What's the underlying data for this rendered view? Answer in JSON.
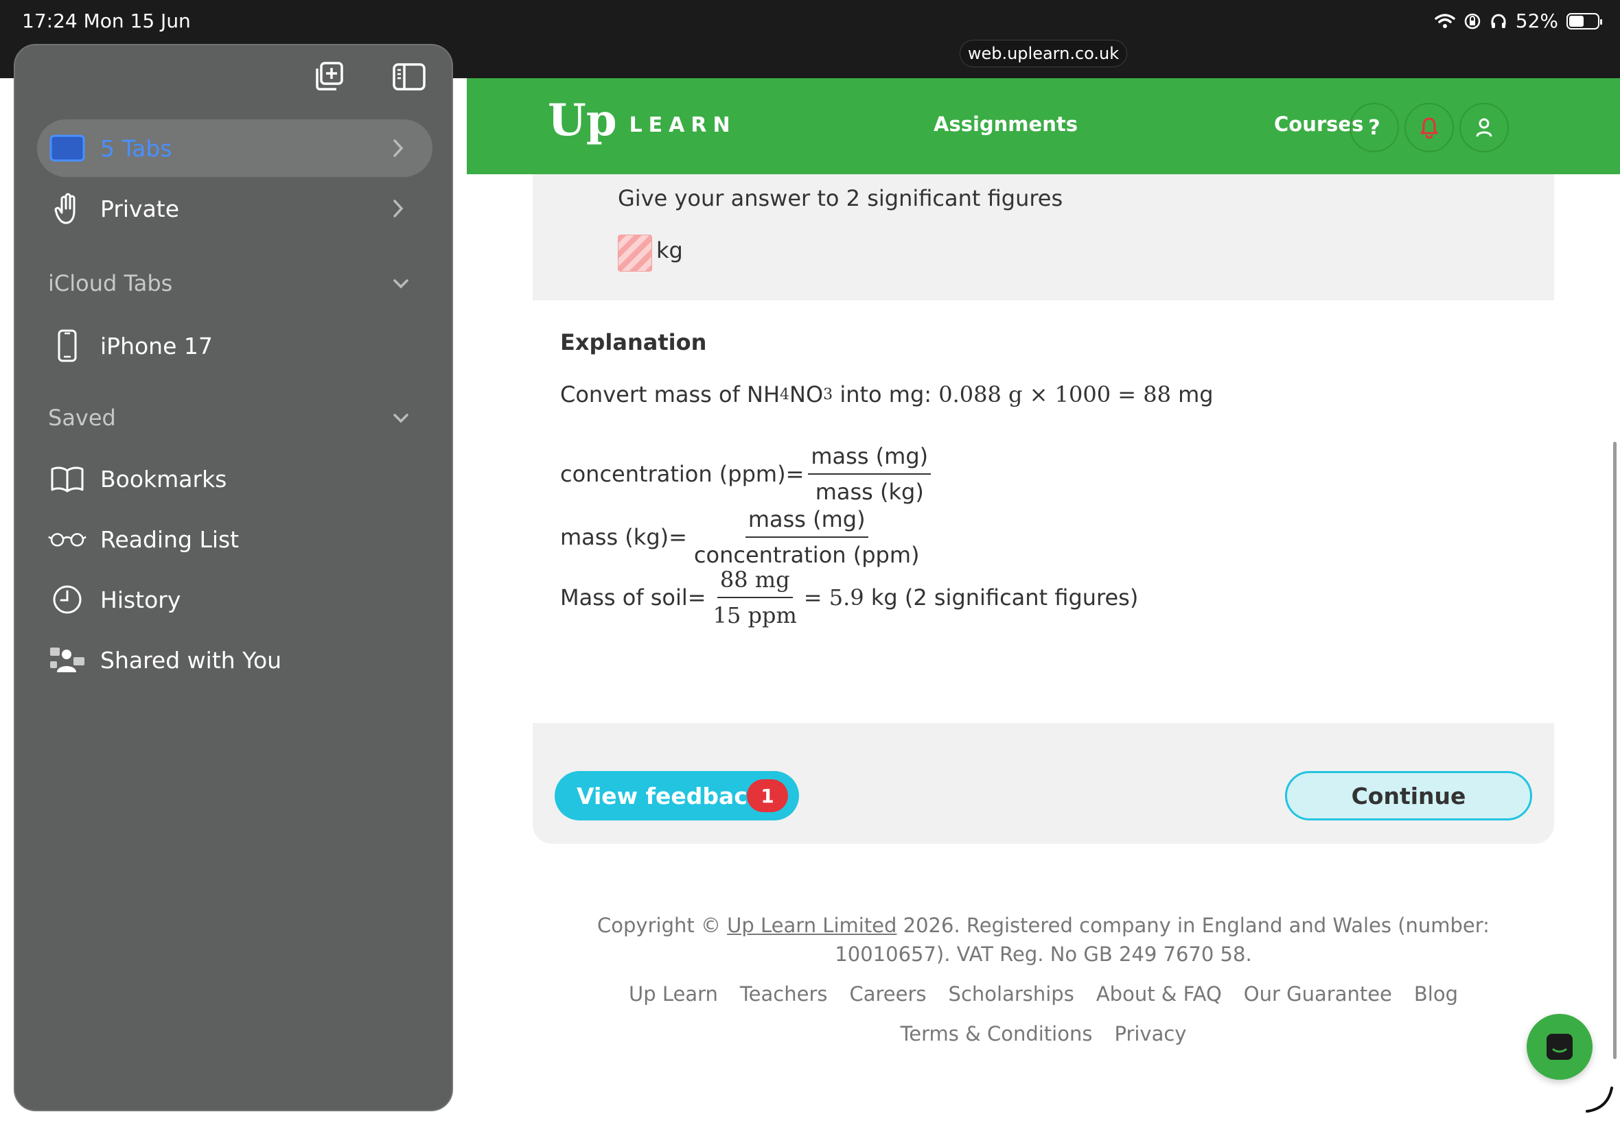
{
  "status": {
    "time": "17:24  Mon 15 Jun",
    "battery": "52%",
    "url": "web.uplearn.co.uk"
  },
  "header": {
    "logo_up": "Up",
    "logo_learn": "LEARN",
    "nav": {
      "assignments": "Assignments",
      "courses": "Courses"
    },
    "help": "?"
  },
  "question": {
    "instruction": "Give your answer to 2 significant figures",
    "unit": "kg"
  },
  "explanation": {
    "title": "Explanation",
    "line1": {
      "prefix": "Convert mass of NH",
      "sub1": "4",
      "mid": "NO",
      "sub2": "3",
      "after": " into mg: ",
      "math": "0.088 g × 1000 = 88 ",
      "unit": "mg"
    },
    "line2": {
      "lhs": "concentration (ppm)=",
      "num": "mass (mg)",
      "den": "mass (kg)"
    },
    "line3": {
      "lhs": "mass (kg)=",
      "num": "mass (mg)",
      "den": "concentration (ppm)"
    },
    "line4": {
      "lhs": "Mass of soil=",
      "num": "88 mg",
      "den": "15 ppm",
      "rhs_math": "= 5.9 ",
      "rhs_text": "kg (2 significant figures)"
    }
  },
  "actions": {
    "view_feedback": "View feedback",
    "feedback_count": "1",
    "continue": "Continue"
  },
  "footer": {
    "copyright_prefix": "Copyright © ",
    "copyright_link": "Up Learn Limited",
    "copyright_rest": " 2026. Registered company in England and Wales (number: 10010657). VAT Reg. No GB 249 7670 58.",
    "links": [
      "Up Learn",
      "Teachers",
      "Careers",
      "Scholarships",
      "About & FAQ",
      "Our Guarantee",
      "Blog"
    ],
    "links2": [
      "Terms & Conditions",
      "Privacy"
    ]
  },
  "sidebar": {
    "tabs": "5 Tabs",
    "private": "Private",
    "icloud_header": "iCloud Tabs",
    "device": "iPhone 17",
    "saved_header": "Saved",
    "bookmarks": "Bookmarks",
    "reading_list": "Reading List",
    "history": "History",
    "shared": "Shared with You"
  },
  "colors": {
    "brand_green": "#3bad45",
    "accent_cyan": "#22c4e0",
    "badge_red": "#e5333a",
    "safari_blue": "#4a90ff"
  }
}
